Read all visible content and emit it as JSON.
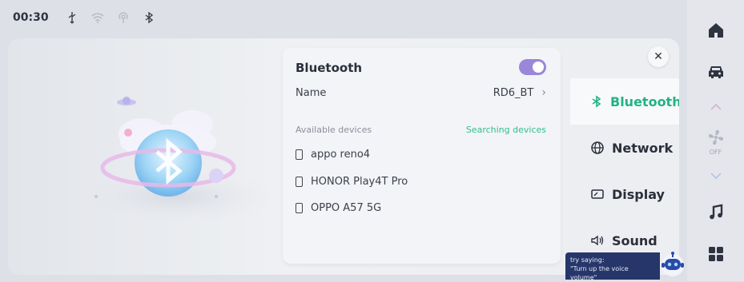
{
  "status": {
    "time": "00:30"
  },
  "bluetooth": {
    "title": "Bluetooth",
    "name_label": "Name",
    "name_value": "RD6_BT",
    "available_label": "Available devices",
    "searching_label": "Searching devices",
    "devices": [
      "appo reno4",
      "HONOR Play4T Pro",
      "OPPO A57 5G"
    ]
  },
  "menu": {
    "items": [
      {
        "label": "Bluetooth"
      },
      {
        "label": "Network"
      },
      {
        "label": "Display"
      },
      {
        "label": "Sound"
      }
    ]
  },
  "voice_hint": {
    "line1": "try saying:",
    "line2": "\"Turn up the voice volume\""
  },
  "sidebar": {
    "fan_state": "OFF"
  },
  "colors": {
    "accent": "#22b383",
    "toggle": "#9a87d8",
    "hint_bg": "#26366a"
  }
}
